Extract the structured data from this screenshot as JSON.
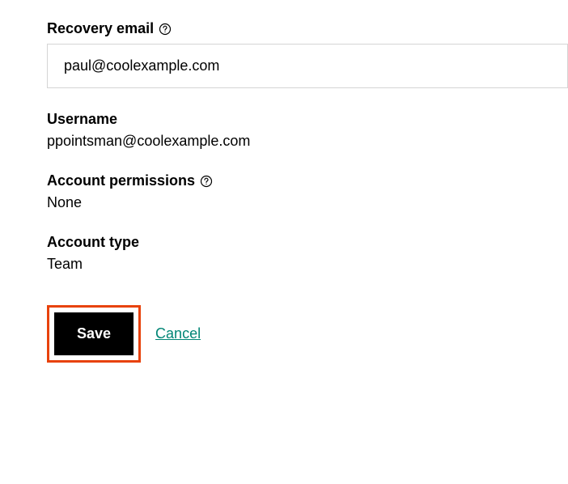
{
  "recovery_email": {
    "label": "Recovery email",
    "value": "paul@coolexample.com"
  },
  "username": {
    "label": "Username",
    "value": "ppointsman@coolexample.com"
  },
  "permissions": {
    "label": "Account permissions",
    "value": "None"
  },
  "account_type": {
    "label": "Account type",
    "value": "Team"
  },
  "actions": {
    "save": "Save",
    "cancel": "Cancel"
  }
}
